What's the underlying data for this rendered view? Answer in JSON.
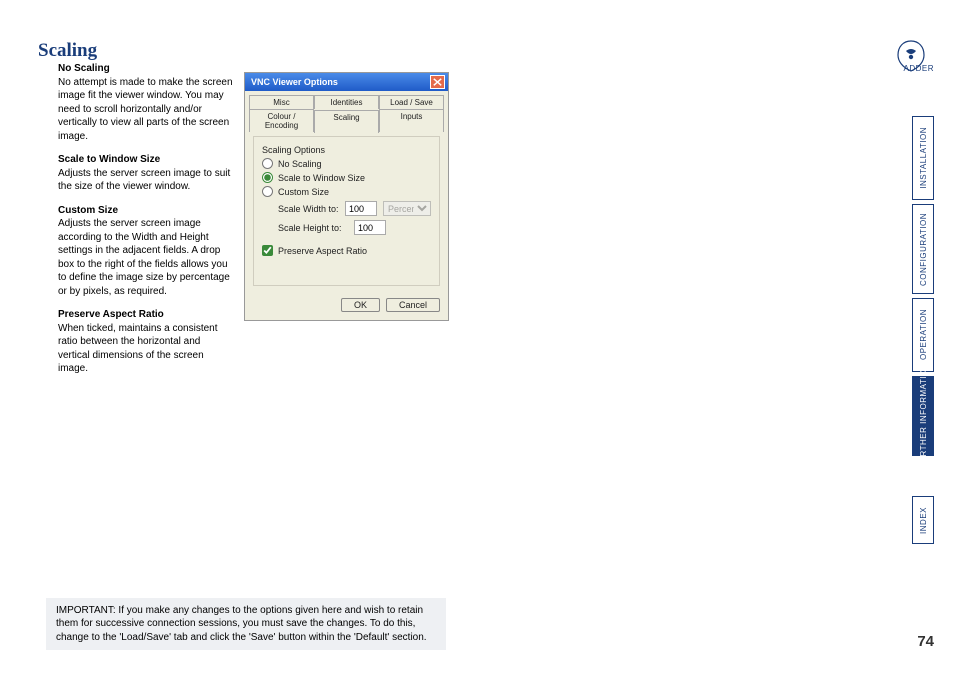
{
  "page": {
    "title": "Scaling",
    "number": "74"
  },
  "sections": {
    "noscaling": {
      "heading": "No Scaling",
      "body": "No attempt is made to make the screen image fit the viewer window. You may need to scroll horizontally and/or vertically to view all parts of the screen image."
    },
    "scaletowin": {
      "heading": "Scale to Window Size",
      "body": "Adjusts the server screen image to suit the size of the viewer window."
    },
    "custom": {
      "heading": "Custom Size",
      "body": "Adjusts the server screen image according to the Width and Height settings in the adjacent fields. A drop box to the right of the fields allows you to define the image size by percentage or by pixels, as required."
    },
    "preserve": {
      "heading": "Preserve Aspect Ratio",
      "body": "When ticked, maintains a consistent ratio between the horizontal and vertical dimensions of the screen image."
    }
  },
  "dialog": {
    "title": "VNC Viewer Options",
    "tabs_row1": [
      "Misc",
      "Identities",
      "Load / Save"
    ],
    "tabs_row2": [
      "Colour / Encoding",
      "Scaling",
      "Inputs"
    ],
    "active_tab": "Scaling",
    "group_legend": "Scaling Options",
    "radios": {
      "noscaling": "No Scaling",
      "scaletowin": "Scale to Window Size",
      "custom": "Custom Size"
    },
    "selected_radio": "scaletowin",
    "scale_width_label": "Scale Width to:",
    "scale_height_label": "Scale Height to:",
    "scale_width_value": "100",
    "scale_height_value": "100",
    "unit": "Percent",
    "preserve_label": "Preserve Aspect Ratio",
    "preserve_checked": true,
    "ok": "OK",
    "cancel": "Cancel"
  },
  "brand": {
    "name": "ADDER"
  },
  "sidenav": {
    "installation": "INSTALLATION",
    "configuration": "CONFIGURATION",
    "operation": "OPERATION",
    "further": "FURTHER\nINFORMATION",
    "index": "INDEX"
  },
  "important": "IMPORTANT: If you make any changes to the options given here and wish to retain them for successive connection sessions, you must save the changes. To do this, change to the 'Load/Save' tab and click the 'Save' button within the 'Default' section."
}
